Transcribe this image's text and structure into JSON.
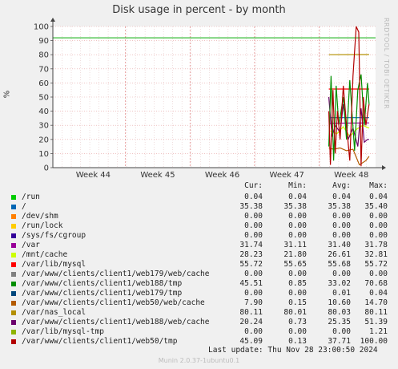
{
  "title": "Disk usage in percent - by month",
  "watermark": "RRDTOOL / TOBI OETIKER",
  "footer": "Munin 2.0.37-1ubuntu0.1",
  "last_update_label": "Last update:",
  "last_update": "Thu Nov 28 23:00:50 2024",
  "legend_headers": [
    "Cur:",
    "Min:",
    "Avg:",
    "Max:"
  ],
  "legend": [
    {
      "name": "/run",
      "color": "#00cc00",
      "cur": "0.04",
      "min": "0.04",
      "avg": "0.04",
      "max": "0.04"
    },
    {
      "name": "/",
      "color": "#0066b3",
      "cur": "35.38",
      "min": "35.38",
      "avg": "35.38",
      "max": "35.40"
    },
    {
      "name": "/dev/shm",
      "color": "#ff8000",
      "cur": "0.00",
      "min": "0.00",
      "avg": "0.00",
      "max": "0.00"
    },
    {
      "name": "/run/lock",
      "color": "#ffcc00",
      "cur": "0.00",
      "min": "0.00",
      "avg": "0.00",
      "max": "0.00"
    },
    {
      "name": "/sys/fs/cgroup",
      "color": "#330099",
      "cur": "0.00",
      "min": "0.00",
      "avg": "0.00",
      "max": "0.00"
    },
    {
      "name": "/var",
      "color": "#990099",
      "cur": "31.74",
      "min": "31.11",
      "avg": "31.40",
      "max": "31.78"
    },
    {
      "name": "/mnt/cache",
      "color": "#ccff00",
      "cur": "28.23",
      "min": "21.80",
      "avg": "26.61",
      "max": "32.81"
    },
    {
      "name": "/var/lib/mysql",
      "color": "#ff0000",
      "cur": "55.72",
      "min": "55.65",
      "avg": "55.68",
      "max": "55.72"
    },
    {
      "name": "/var/www/clients/client1/web179/web/cache",
      "color": "#808080",
      "cur": "0.00",
      "min": "0.00",
      "avg": "0.00",
      "max": "0.00"
    },
    {
      "name": "/var/www/clients/client1/web188/tmp",
      "color": "#008f00",
      "cur": "45.51",
      "min": "0.85",
      "avg": "33.02",
      "max": "70.68"
    },
    {
      "name": "/var/www/clients/client1/web179/tmp",
      "color": "#00487d",
      "cur": "0.00",
      "min": "0.00",
      "avg": "0.01",
      "max": "0.04"
    },
    {
      "name": "/var/www/clients/client1/web50/web/cache",
      "color": "#b35a00",
      "cur": "7.90",
      "min": "0.15",
      "avg": "10.60",
      "max": "14.70"
    },
    {
      "name": "/var/nas_local",
      "color": "#b38f00",
      "cur": "80.11",
      "min": "80.01",
      "avg": "80.03",
      "max": "80.11"
    },
    {
      "name": "/var/www/clients/client1/web188/web/cache",
      "color": "#6b006b",
      "cur": "20.24",
      "min": "0.73",
      "avg": "25.35",
      "max": "51.39"
    },
    {
      "name": "/var/lib/mysql-tmp",
      "color": "#8fb300",
      "cur": "0.00",
      "min": "0.00",
      "avg": "0.00",
      "max": "1.21"
    },
    {
      "name": "/var/www/clients/client1/web50/tmp",
      "color": "#b30000",
      "cur": "45.09",
      "min": "0.13",
      "avg": "37.71",
      "max": "100.00"
    }
  ],
  "chart_data": {
    "type": "line",
    "title": "Disk usage in percent - by month",
    "ylabel": "%",
    "ylim": [
      0,
      100
    ],
    "yticks": [
      0,
      10,
      20,
      30,
      40,
      50,
      60,
      70,
      80,
      90,
      100
    ],
    "x_ticks": [
      "Week 44",
      "Week 45",
      "Week 46",
      "Week 47",
      "Week 48"
    ],
    "grid": true,
    "horizontal_rule": {
      "value": 92,
      "color": "#00aa00"
    },
    "series": [
      {
        "name": "/",
        "color": "#0066b3",
        "x": [
          0.855,
          0.98
        ],
        "values": [
          35.4,
          35.4
        ]
      },
      {
        "name": "/var",
        "color": "#990099",
        "x": [
          0.855,
          0.98
        ],
        "values": [
          31.5,
          31.7
        ]
      },
      {
        "name": "/var/lib/mysql",
        "color": "#ff0000",
        "x": [
          0.855,
          0.98
        ],
        "values": [
          55.7,
          55.7
        ]
      },
      {
        "name": "/var/nas_local",
        "color": "#b38f00",
        "x": [
          0.855,
          0.98
        ],
        "values": [
          80.0,
          80.1
        ]
      },
      {
        "name": "/mnt/cache",
        "color": "#ccff00",
        "x": [
          0.86,
          0.88,
          0.9,
          0.92,
          0.94,
          0.96,
          0.98
        ],
        "values": [
          26,
          24,
          29,
          22,
          27,
          30,
          28
        ]
      },
      {
        "name": "/var/www/clients/client1/web50/web/cache",
        "color": "#b35a00",
        "x": [
          0.855,
          0.87,
          0.89,
          0.91,
          0.93,
          0.95,
          0.97,
          0.98
        ],
        "values": [
          14,
          13,
          14,
          12,
          13,
          2,
          5,
          8
        ]
      },
      {
        "name": "/var/www/clients/client1/web188/web/cache",
        "color": "#6b006b",
        "x": [
          0.855,
          0.865,
          0.875,
          0.89,
          0.9,
          0.915,
          0.93,
          0.945,
          0.955,
          0.965,
          0.975,
          0.98
        ],
        "values": [
          50,
          22,
          30,
          25,
          45,
          20,
          28,
          15,
          42,
          18,
          20,
          20
        ]
      },
      {
        "name": "/var/www/clients/client1/web188/tmp",
        "color": "#008f00",
        "x": [
          0.855,
          0.862,
          0.87,
          0.878,
          0.886,
          0.9,
          0.91,
          0.92,
          0.935,
          0.945,
          0.955,
          0.965,
          0.975,
          0.98
        ],
        "values": [
          15,
          65,
          5,
          58,
          30,
          50,
          20,
          62,
          12,
          55,
          66,
          30,
          60,
          45
        ]
      },
      {
        "name": "/var/www/clients/client1/web50/tmp",
        "color": "#b30000",
        "x": [
          0.855,
          0.86,
          0.868,
          0.875,
          0.882,
          0.89,
          0.9,
          0.91,
          0.92,
          0.93,
          0.94,
          0.948,
          0.955,
          0.962,
          0.97,
          0.98
        ],
        "values": [
          40,
          2,
          55,
          10,
          40,
          20,
          58,
          30,
          5,
          65,
          100,
          96,
          1,
          50,
          30,
          45
        ]
      }
    ]
  }
}
